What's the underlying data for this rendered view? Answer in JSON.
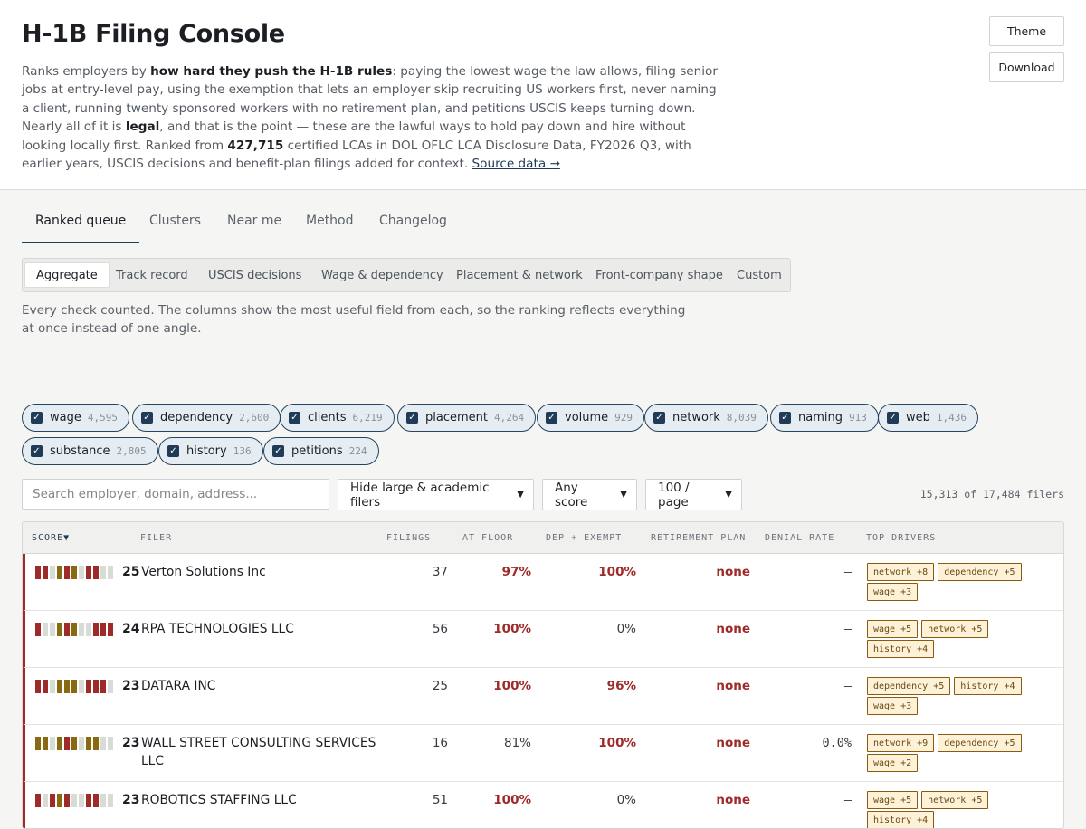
{
  "header": {
    "title": "H-1B Filing Console",
    "intro": {
      "p1": "Ranks employers by ",
      "b1": "how hard they push the H-1B rules",
      "p2": ": paying the lowest wage the law allows, filing senior jobs at entry-level pay, using the exemption that lets an employer skip recruiting US workers first, never naming a client, running twenty sponsored workers with no retirement plan, and petitions USCIS keeps turning down. Nearly all of it is ",
      "b2": "legal",
      "p3": ", and that is the point — these are the lawful ways to hold pay down and hire without looking locally first. Ranked from ",
      "b3": "427,715",
      "p4": " certified LCAs in DOL OFLC LCA Disclosure Data, FY2026 Q3, with earlier years, USCIS decisions and benefit-plan filings added for context. ",
      "link": "Source data →"
    },
    "theme_label": "Theme",
    "download_label": "Download"
  },
  "tabs": [
    "Ranked queue",
    "Clusters",
    "Near me",
    "Method",
    "Changelog"
  ],
  "subtabs": [
    "Aggregate",
    "Track record",
    "USCIS decisions",
    "Wage & dependency",
    "Placement & network",
    "Front-company shape",
    "Custom"
  ],
  "note": "Every check counted. The columns show the most useful field from each, so the ranking reflects everything at once instead of one angle.",
  "chips": [
    {
      "label": "wage",
      "count": "4,595"
    },
    {
      "label": "dependency",
      "count": "2,600"
    },
    {
      "label": "clients",
      "count": "6,219"
    },
    {
      "label": "placement",
      "count": "4,264"
    },
    {
      "label": "volume",
      "count": "929"
    },
    {
      "label": "network",
      "count": "8,039"
    },
    {
      "label": "naming",
      "count": "913"
    },
    {
      "label": "web",
      "count": "1,436"
    },
    {
      "label": "substance",
      "count": "2,805"
    },
    {
      "label": "history",
      "count": "136"
    },
    {
      "label": "petitions",
      "count": "224"
    }
  ],
  "controls": {
    "search_placeholder": "Search employer, domain, address...",
    "filter_select": "Hide large & academic filers",
    "score_select": "Any score",
    "page_select": "100 / page",
    "filers_count": "15,313 of 17,484 filers"
  },
  "table": {
    "columns": [
      "SCORE▼",
      "FILER",
      "FILINGS",
      "AT FLOOR",
      "DEP + EXEMPT",
      "RETIREMENT PLAN",
      "DENIAL RATE",
      "TOP DRIVERS"
    ],
    "rows": [
      {
        "score": "25",
        "filer": "Verton Solutions Inc",
        "filings": "37",
        "at_floor": "97%",
        "dep_exempt": "100%",
        "retirement": "none",
        "denial": "—",
        "drivers": [
          "network +8",
          "dependency +5",
          "wage +3"
        ],
        "bars": [
          "r",
          "r",
          "g",
          "o",
          "r",
          "o",
          "g",
          "r",
          "r",
          "g",
          "g"
        ]
      },
      {
        "score": "24",
        "filer": "RPA TECHNOLOGIES LLC",
        "filings": "56",
        "at_floor": "100%",
        "dep_exempt": "0%",
        "retirement": "none",
        "denial": "—",
        "drivers": [
          "wage +5",
          "network +5",
          "history +4"
        ],
        "bars": [
          "r",
          "g",
          "g",
          "o",
          "r",
          "o",
          "g",
          "g",
          "r",
          "r",
          "r"
        ]
      },
      {
        "score": "23",
        "filer": "DATARA INC",
        "filings": "25",
        "at_floor": "100%",
        "dep_exempt": "96%",
        "retirement": "none",
        "denial": "—",
        "drivers": [
          "dependency +5",
          "history +4",
          "wage +3"
        ],
        "bars": [
          "r",
          "r",
          "g",
          "o",
          "o",
          "o",
          "g",
          "r",
          "r",
          "r",
          "g"
        ]
      },
      {
        "score": "23",
        "filer": "WALL STREET CONSULTING SERVICES LLC",
        "filings": "16",
        "at_floor": "81%",
        "dep_exempt": "100%",
        "retirement": "none",
        "denial": "0.0%",
        "drivers": [
          "network +9",
          "dependency +5",
          "wage +2"
        ],
        "bars": [
          "o",
          "o",
          "g",
          "o",
          "r",
          "o",
          "g",
          "o",
          "o",
          "g",
          "g"
        ]
      },
      {
        "score": "23",
        "filer": "ROBOTICS STAFFING LLC",
        "filings": "51",
        "at_floor": "100%",
        "dep_exempt": "0%",
        "retirement": "none",
        "denial": "—",
        "drivers": [
          "wage +5",
          "network +5",
          "history +4"
        ],
        "bars": [
          "r",
          "g",
          "r",
          "o",
          "r",
          "g",
          "g",
          "r",
          "r",
          "g",
          "g"
        ]
      }
    ]
  },
  "colors": {
    "accent": "#1f3b57",
    "red": "#9e2a2a",
    "olive": "#8a6a10",
    "gray": "#d8dbd6"
  }
}
